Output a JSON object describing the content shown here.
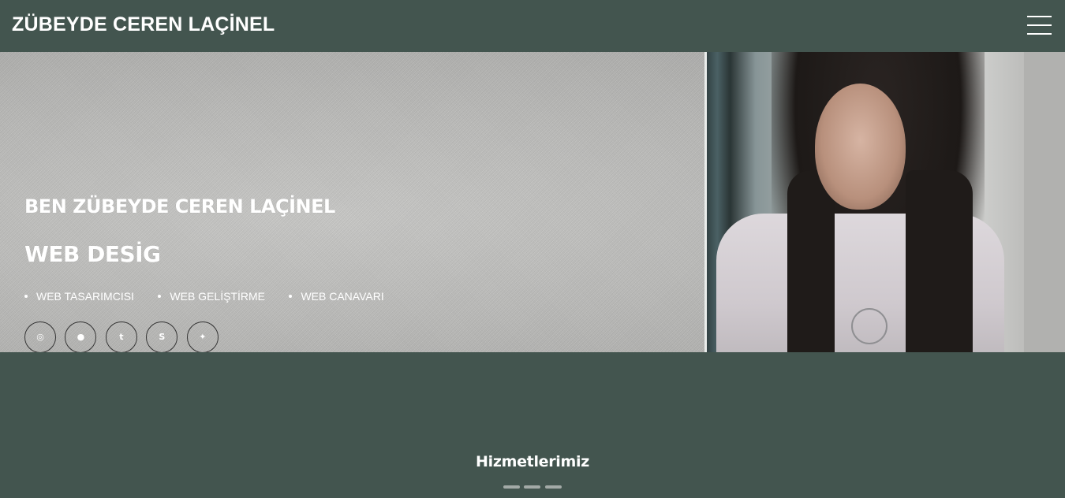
{
  "navbar": {
    "brand": "ZÜBEYDE CEREN LAÇİNEL",
    "menu_icon": "hamburger-menu-icon"
  },
  "hero": {
    "greeting": "BEN ZÜBEYDE CEREN LAÇİNEL",
    "role": "WEB DESİG",
    "skills": [
      "WEB TASARIMCISI",
      "WEB GELİŞTİRME",
      "WEB CANAVARI"
    ],
    "socials": [
      {
        "icon": "instagram-icon",
        "glyph": "◎"
      },
      {
        "icon": "apple-icon",
        "glyph": "●"
      },
      {
        "icon": "tumblr-icon",
        "glyph": "t"
      },
      {
        "icon": "skype-icon",
        "glyph": "S"
      },
      {
        "icon": "twitter-icon",
        "glyph": "✦"
      }
    ],
    "photo": "portrait-photo"
  },
  "services": {
    "title": "Hizmetlerimiz"
  },
  "colors": {
    "background": "#43554f",
    "text": "#ffffff",
    "divider": "#a3aaa7"
  }
}
